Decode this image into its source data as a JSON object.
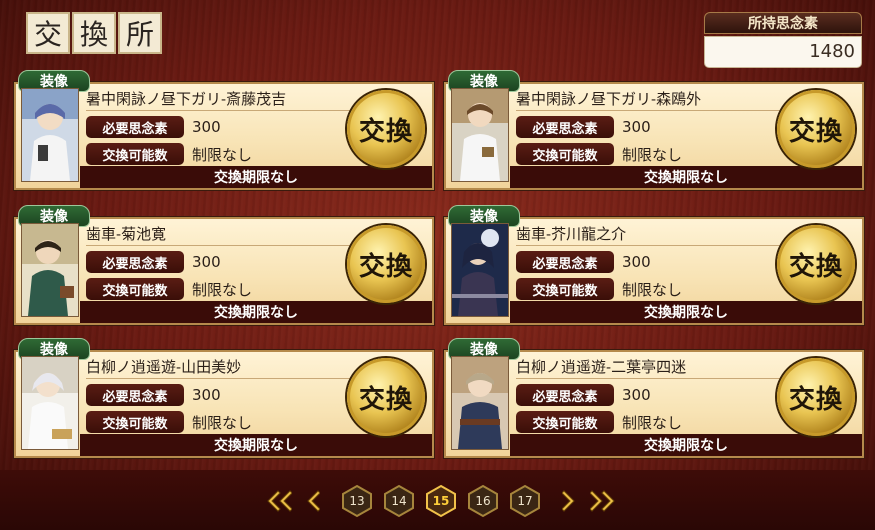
{
  "title_chars": [
    "交",
    "換",
    "所"
  ],
  "points": {
    "label": "所持思念素",
    "value": "1480"
  },
  "card_labels": {
    "tag": "装像",
    "cost_label": "必要思念素",
    "limit_count_label": "交換可能数",
    "exchange_button": "交換"
  },
  "items": [
    {
      "name": "暑中閑詠ノ昼下ガリ-斎藤茂吉",
      "cost": "300",
      "limit_count": "制限なし",
      "period": "交換期限なし"
    },
    {
      "name": "暑中閑詠ノ昼下ガリ-森鴎外",
      "cost": "300",
      "limit_count": "制限なし",
      "period": "交換期限なし"
    },
    {
      "name": "歯車-菊池寛",
      "cost": "300",
      "limit_count": "制限なし",
      "period": "交換期限なし"
    },
    {
      "name": "歯車-芥川龍之介",
      "cost": "300",
      "limit_count": "制限なし",
      "period": "交換期限なし"
    },
    {
      "name": "白柳ノ逍遥遊-山田美妙",
      "cost": "300",
      "limit_count": "制限なし",
      "period": "交換期限なし"
    },
    {
      "name": "白柳ノ逍遥遊-二葉亭四迷",
      "cost": "300",
      "limit_count": "制限なし",
      "period": "交換期限なし"
    }
  ],
  "pager": {
    "pages": [
      "13",
      "14",
      "15",
      "16",
      "17"
    ],
    "current": "15"
  },
  "colors": {
    "accent_gold": "#e9c552",
    "tag_green": "#2f6a35",
    "label_maroon": "#5a1d14"
  }
}
